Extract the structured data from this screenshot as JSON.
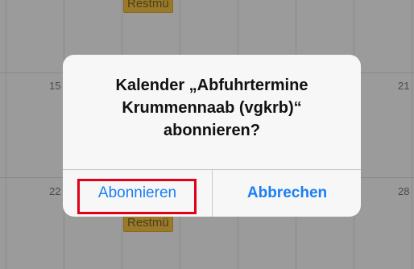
{
  "calendar": {
    "day_numbers": [
      "15",
      "21",
      "22",
      "28"
    ],
    "event_label_top": "Restmü",
    "event_label_bottom": "Restmü",
    "event_color": "#9a7a2a"
  },
  "dialog": {
    "title_line1": "Kalender „Abfuhrtermine",
    "title_line2": "Krummennaab (vgkrb)“",
    "title_line3": "abonnieren?",
    "subscribe_label": "Abonnieren",
    "cancel_label": "Abbrechen",
    "accent_color": "#1a7ff5",
    "highlight_color": "#e0001a"
  }
}
